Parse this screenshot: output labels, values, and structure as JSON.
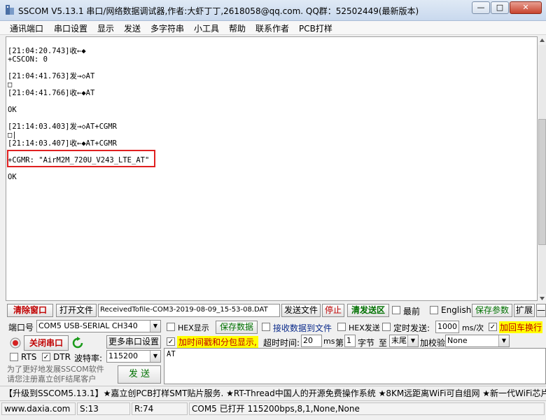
{
  "window": {
    "title": "SSCOM V5.13.1 串口/网络数据调试器,作者:大虾丁丁,2618058@qq.com. QQ群：52502449(最新版本)",
    "controls": {
      "minimize": "—",
      "maximize": "□",
      "close": "✕"
    }
  },
  "menu": [
    "通讯端口",
    "串口设置",
    "显示",
    "发送",
    "多字符串",
    "小工具",
    "帮助",
    "联系作者",
    "PCB打样"
  ],
  "log": [
    "[21:04:20.743]收←◆",
    "+CSCON: 0",
    "",
    "[21:04:41.763]发→◇AT",
    "□",
    "[21:04:41.766]收←◆AT",
    "",
    "OK",
    "",
    "[21:14:03.403]发→◇AT+CGMR",
    "□|",
    "[21:14:03.407]收←◆AT+CGMR",
    "",
    "+CGMR: \"AirM2M_720U_V243_LTE_AT\"",
    "",
    "OK"
  ],
  "toolbar1": {
    "clear_window": "清除窗口",
    "open_file": "打开文件",
    "file_path": "ReceivedTofile-COM3-2019-08-09_15-53-08.DAT",
    "send_file": "发送文件",
    "stop": "停止",
    "clear_send": "清发送区",
    "topmost_label": "最前",
    "english_label": "English",
    "save_params": "保存参数",
    "expand": "扩展",
    "collapse": "—"
  },
  "port_panel": {
    "port_label": "端口号",
    "port_value": "COM5 USB-SERIAL CH340",
    "close_port": "关闭串口",
    "more_settings": "更多串口设置",
    "rts_label": "RTS",
    "dtr_label": "DTR",
    "baud_label": "波特率:",
    "baud_value": "115200",
    "promo": "为了更好地发展SSCOM软件\n请您注册嘉立创F结尾客户",
    "send_button": "发  送"
  },
  "options_row1": {
    "hex_display": "HEX显示",
    "save_data": "保存数据",
    "recv_to_file": "接收数据到文件",
    "hex_send": "HEX发送",
    "timed_send": "定时发送:",
    "interval_value": "1000",
    "interval_unit": "ms/次",
    "add_crlf": "加回车换行"
  },
  "options_row2": {
    "timestamp": "加时间戳和分包显示,",
    "timeout_label": "超时时间:",
    "timeout_value": "20",
    "timeout_unit": "ms",
    "byte_prefix": "第",
    "byte_index": "1",
    "byte_label": "字节",
    "to_label": "至",
    "end_value": "末尾",
    "checksum_label": "加校验",
    "checksum_value": "None"
  },
  "send_text": "AT",
  "ticker": "【升级到SSCOM5.13.1】★嘉立创PCB打样SMT贴片服务. ★RT-Thread中国人的开源免费操作系统 ★8KM远距离WiFi可自组网 ★新一代WiFi芯片兼",
  "status_bar": {
    "website": "www.daxia.com",
    "sent": "S:13",
    "received": "R:74",
    "port_status": "COM5 已打开  115200bps,8,1,None,None"
  }
}
